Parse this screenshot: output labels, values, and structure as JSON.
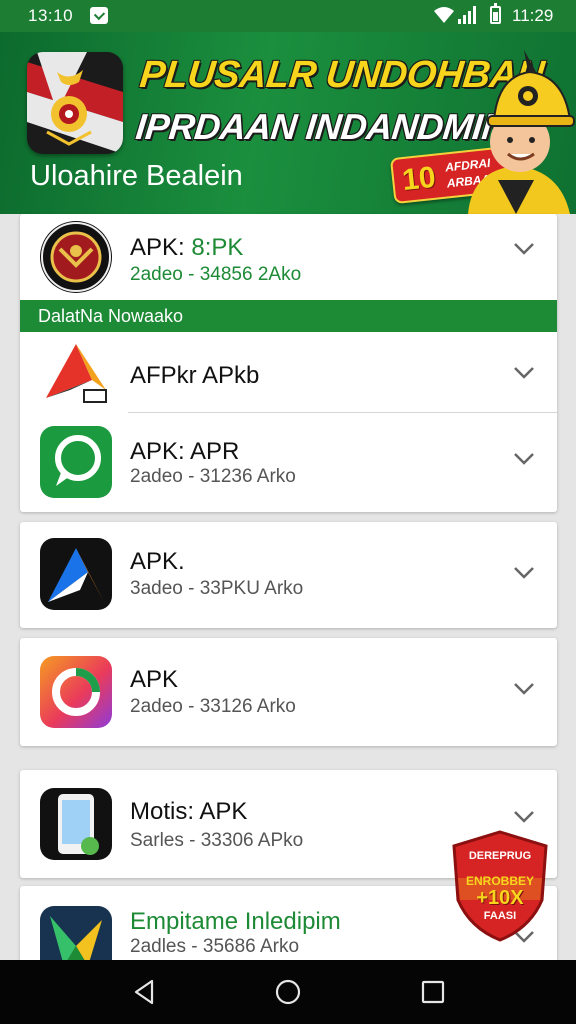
{
  "status_bar": {
    "time_left": "13:10",
    "time_right": "11:29",
    "icons": [
      "notification-icon",
      "wifi-icon",
      "signal-icon",
      "battery-icon"
    ]
  },
  "banner": {
    "title_line1": "PLUSALR UNDOHBAN",
    "title_line2": "IPRDAAN INDANDMIN",
    "subtitle": "Uloahire Bealein",
    "promo": {
      "number": "10",
      "text_line1": "AFDRAI",
      "text_line2": "ARBAAI"
    }
  },
  "section_header": "DalatNa Nowaako",
  "apps": [
    {
      "name": "APK: ",
      "name_accent": "8:PK",
      "meta": "2adeo - 34856 2Ako",
      "icon": "emblem-icon",
      "meta_color": "#1d8a35"
    },
    {
      "name": "AFPkr APkb",
      "meta": "",
      "icon": "paper-plane-icon"
    },
    {
      "name": "APK: APR",
      "meta": "2adeo - 31236 Arko",
      "icon": "chat-bubble-icon"
    },
    {
      "name": "APK.",
      "meta": "3adeo - 33PKU Arko",
      "icon": "arrow-logo-icon"
    },
    {
      "name": "APK",
      "meta": "2adeo - 33126 Arko",
      "icon": "ring-logo-icon"
    },
    {
      "name": "Motis: APK",
      "meta": "Sarles - 33306 APko",
      "icon": "phone-icon"
    },
    {
      "name": "Empitame  Inledipim",
      "meta": "2adles - 35686 Arko",
      "icon": "chevron-logo-icon",
      "name_color": "#1d8a35"
    }
  ],
  "sale_badge": {
    "line1": "DEREPRUG",
    "line2": "ENROBBEY",
    "line3": "+10X",
    "line4": "FAASI"
  },
  "nav_bar": {
    "buttons": [
      "back-icon",
      "home-icon",
      "recents-icon"
    ]
  },
  "colors": {
    "primary_green": "#1d8a35",
    "banner_yellow": "#f7d51d",
    "badge_red": "#d62424"
  }
}
